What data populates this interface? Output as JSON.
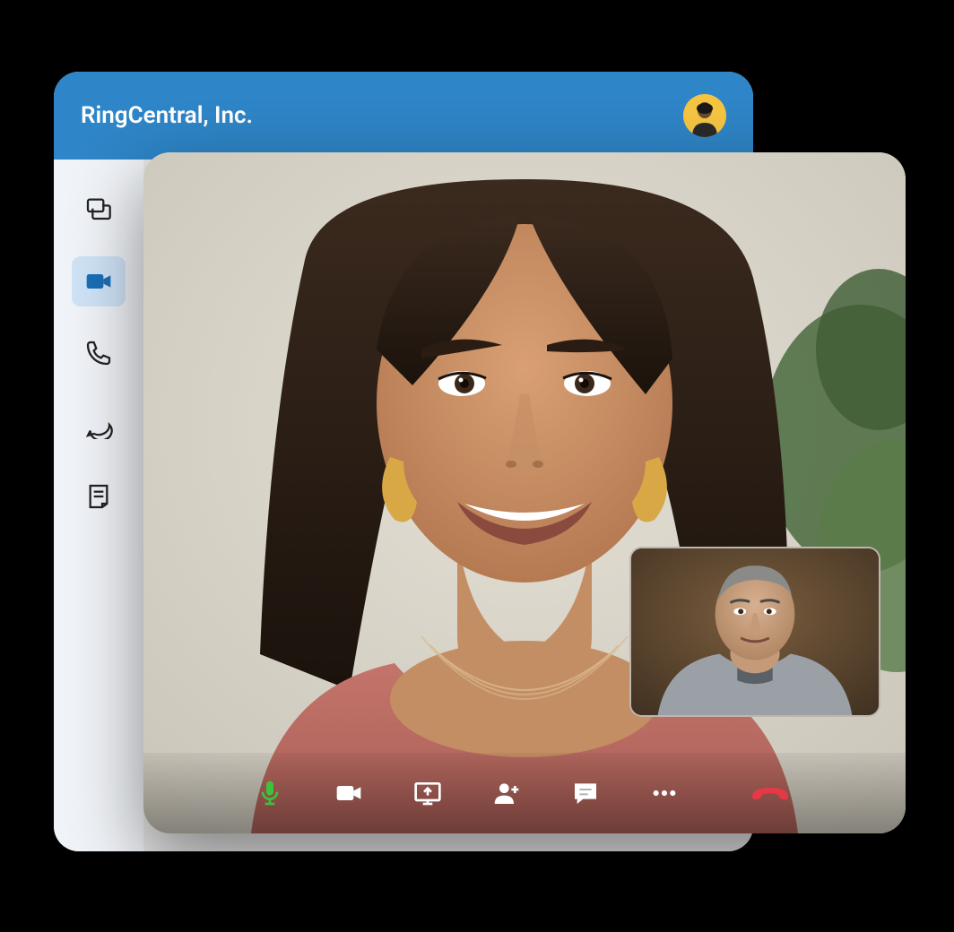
{
  "header": {
    "title": "RingCentral, Inc.",
    "avatar_bg": "#f5c542"
  },
  "sidebar": {
    "items": [
      {
        "name": "messages",
        "icon": "messages-icon",
        "active": false
      },
      {
        "name": "video",
        "icon": "video-icon",
        "active": true
      },
      {
        "name": "phone",
        "icon": "phone-icon",
        "active": false
      },
      {
        "name": "chat",
        "icon": "chat-icon",
        "active": false
      },
      {
        "name": "notes",
        "icon": "notes-icon",
        "active": false
      }
    ]
  },
  "video_call": {
    "remote_participant": "Remote participant video",
    "self_view": "Self preview video",
    "toolbar": {
      "mute": {
        "icon": "microphone-icon",
        "color": "#3fc13c"
      },
      "camera": {
        "icon": "camera-icon",
        "color": "#ffffff"
      },
      "screen_share": {
        "icon": "screen-share-icon",
        "color": "#ffffff"
      },
      "add_participant": {
        "icon": "add-person-icon",
        "color": "#ffffff"
      },
      "chat": {
        "icon": "chat-message-icon",
        "color": "#ffffff"
      },
      "more": {
        "icon": "more-icon",
        "color": "#ffffff"
      },
      "end_call": {
        "icon": "end-call-icon",
        "color": "#e63946"
      }
    }
  },
  "colors": {
    "header_bg": "#2e85c7",
    "sidebar_bg": "#f0f3f7",
    "sidebar_active_bg": "#cfe3f7",
    "sidebar_active_fg": "#1a6fb5",
    "mic_active": "#3fc13c",
    "end_call": "#e63946"
  }
}
